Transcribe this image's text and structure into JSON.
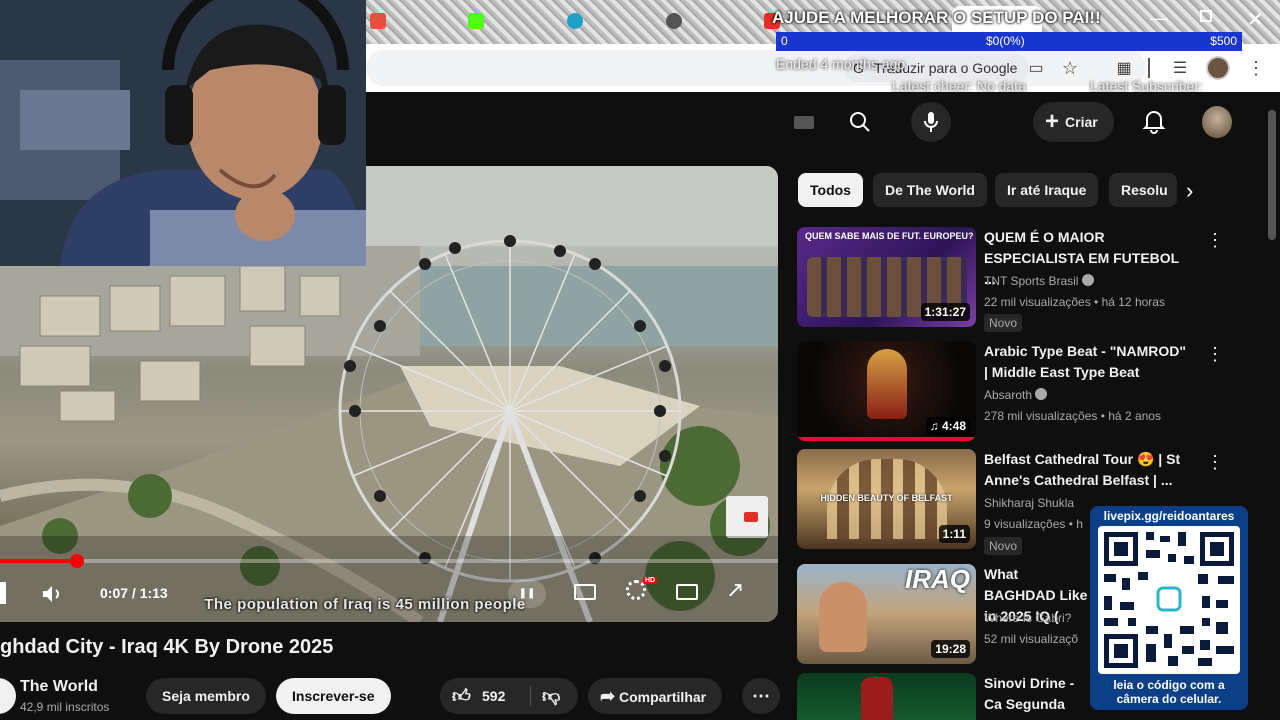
{
  "stream_overlay": {
    "banner_title": "AJUDE A MELHORAR O SETUP DO PAI!!",
    "goal_start": "0",
    "goal_current": "$0(0%)",
    "goal_end": "$500",
    "ended_text": "Ended 4 months ago",
    "latest_cheer": "Latest cheer: No data",
    "latest_subscriber": "Latest Subscriber:",
    "qr_url": "livepix.gg/reidoantares",
    "qr_caption": "leia o código com a câmera do celular."
  },
  "browser": {
    "translate_label": "Traduzir para o Google"
  },
  "header": {
    "create_label": "Criar"
  },
  "player": {
    "time": "0:07 / 1:13",
    "progress": 0.099,
    "subtitle": "The population of Iraq is 45 million people",
    "hd_badge": "HD"
  },
  "video": {
    "title": "ghdad City - Iraq 4K By Drone 2025",
    "channel": "The World",
    "subscribers": "42,9 mil inscritos",
    "join_label": "Seja membro",
    "subscribe_label": "Inscrever-se",
    "likes": "592",
    "share_label": "Compartilhar"
  },
  "chips": [
    "Todos",
    "De The World",
    "Ir até Iraque",
    "Resolu"
  ],
  "related": [
    {
      "title": "QUEM É O MAIOR ESPECIALISTA EM FUTEBOL ...",
      "channel": "TNT Sports Brasil",
      "meta": "22 mil visualizações • há 12 horas",
      "badge": "Novo",
      "duration": "1:31:27",
      "thumb_text": "QUEM SABE MAIS DE FUT. EUROPEU?"
    },
    {
      "title": "Arabic Type Beat - \"NAMROD\" | Middle East Type Beat",
      "channel": "Absaroth",
      "meta": "278 mil visualizações • há 2 anos",
      "duration": "4:48"
    },
    {
      "title": "Belfast Cathedral Tour 😍 | St Anne's Cathedral Belfast | ...",
      "channel": "Shikharaj Shukla",
      "meta": "9 visualizações • h",
      "badge": "Novo",
      "duration": "1:11",
      "thumb_text": "HIDDEN BEAUTY OF BELFAST"
    },
    {
      "title": "What BAGHDAD Like in 2025 IQ (",
      "channel": "Where Is Gabri?",
      "meta": "52 mil visualizaçõ",
      "duration": "19:28",
      "thumb_text": "IRAQ"
    },
    {
      "title": "Sinovi Drine - Ca Segunda Guerra"
    }
  ],
  "colors": {
    "yt_red": "#ff0000",
    "qr_card": "#0d3f86"
  }
}
